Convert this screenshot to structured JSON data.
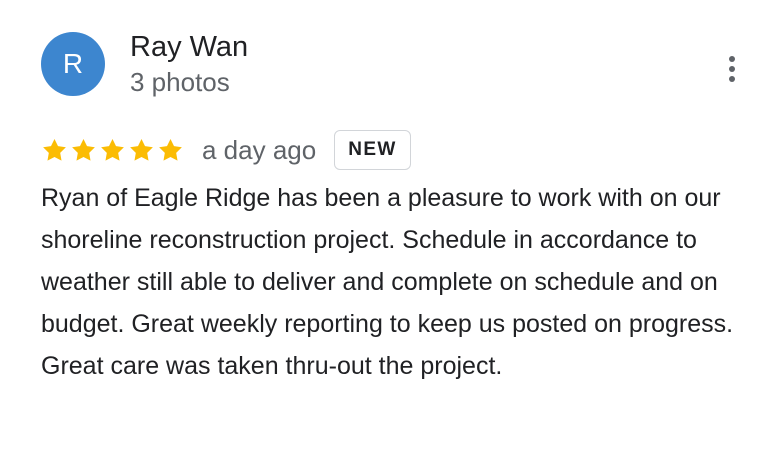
{
  "review": {
    "avatar_letter": "R",
    "avatar_color": "#3d86cf",
    "reviewer_name": "Ray Wan",
    "reviewer_meta": "3 photos",
    "more_icon": "more-vert-icon",
    "rating": 5,
    "rating_max": 5,
    "star_color": "#fbbc04",
    "date": "a day ago",
    "badge": "NEW",
    "text": "Ryan of Eagle Ridge has been a pleasure to work with on our shoreline reconstruction project. Schedule in accordance to weather still able to deliver and complete on schedule and on budget. Great weekly reporting to keep us posted on progress. Great care was taken thru-out the project."
  }
}
